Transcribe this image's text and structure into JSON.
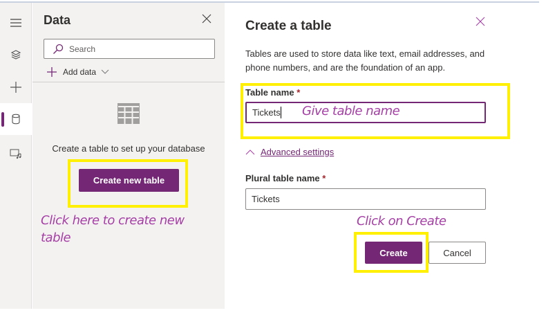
{
  "rail": {
    "items": [
      "menu",
      "layers",
      "insert",
      "data",
      "media"
    ]
  },
  "data_panel": {
    "title": "Data",
    "search_placeholder": "Search",
    "add_data": "Add data",
    "empty_text": "Create a table to set up your database",
    "create_button": "Create new table",
    "annotation": "Click here to create new table"
  },
  "dialog": {
    "title": "Create a table",
    "description": "Tables are used to store data like text, email addresses, and phone numbers, and are the foundation of an app.",
    "table_name_label": "Table name",
    "required_mark": "*",
    "table_name_value": "Tickets",
    "table_name_annotation": "Give table name",
    "advanced_settings": "Advanced settings",
    "plural_label": "Plural table name",
    "plural_value": "Tickets",
    "create_annotation": "Click on Create",
    "create_button": "Create",
    "cancel_button": "Cancel"
  },
  "colors": {
    "accent": "#742774",
    "highlight": "#ffef00",
    "annotation": "#a53fa5"
  }
}
